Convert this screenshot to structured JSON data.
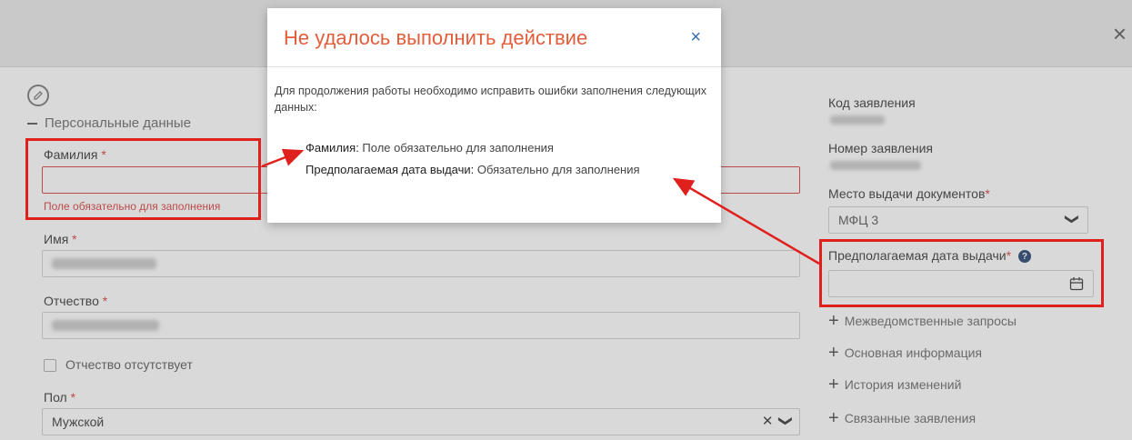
{
  "header": {
    "close_icon": "close-icon"
  },
  "left": {
    "section_title": "Персональные данные",
    "fields": {
      "surname": {
        "label": "Фамилия",
        "required_mark": "*",
        "error": "Поле обязательно для заполнения"
      },
      "name": {
        "label": "Имя",
        "required_mark": "*"
      },
      "patronymic": {
        "label": "Отчество",
        "required_mark": "*"
      },
      "no_patronymic": {
        "label": "Отчество отсутствует"
      },
      "gender": {
        "label": "Пол",
        "required_mark": "*",
        "value": "Мужской",
        "clear": "✕",
        "chevron": "❯"
      }
    }
  },
  "right": {
    "code_label": "Код заявления",
    "number_label": "Номер заявления",
    "place_label": "Место выдачи документов",
    "place_required": "*",
    "place_value": "МФЦ 3",
    "date_label": "Предполагаемая дата выдачи",
    "date_required": "*",
    "help": "?",
    "expanders": [
      "Межведомственные запросы",
      "Основная информация",
      "История изменений",
      "Связанные заявления"
    ]
  },
  "modal": {
    "title": "Не удалось выполнить действие",
    "close": "×",
    "intro": "Для продолжения работы необходимо исправить ошибки заполнения следующих данных:",
    "errors": [
      {
        "field": "Фамилия:",
        "message": " Поле обязательно для заполнения"
      },
      {
        "field": "Предполагаемая дата выдачи:",
        "message": " Обязательно для заполнения"
      }
    ]
  },
  "colors": {
    "error": "#d83a3a",
    "title": "#e25d3a",
    "annotation": "#e0201c",
    "help": "#1e3d6e"
  }
}
